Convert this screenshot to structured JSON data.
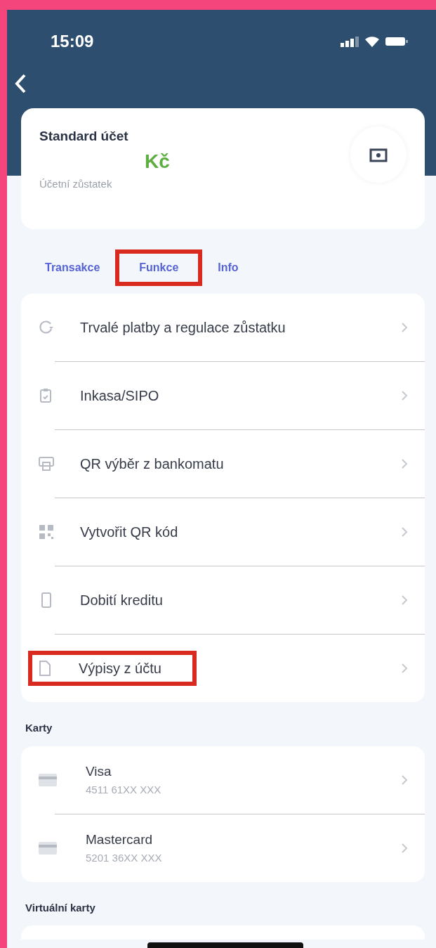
{
  "status_bar": {
    "time": "15:09"
  },
  "account": {
    "title": "Standard účet",
    "balance_currency": "Kč",
    "balance_label": "Účetní zůstatek"
  },
  "tabs": [
    {
      "label": "Transakce",
      "highlighted": false
    },
    {
      "label": "Funkce",
      "highlighted": true
    },
    {
      "label": "Info",
      "highlighted": false
    }
  ],
  "functions": [
    {
      "label": "Trvalé platby a regulace zůstatku",
      "highlighted": false
    },
    {
      "label": "Inkasa/SIPO",
      "highlighted": false
    },
    {
      "label": "QR výběr z bankomatu",
      "highlighted": false
    },
    {
      "label": "Vytvořit QR kód",
      "highlighted": false
    },
    {
      "label": "Dobití kreditu",
      "highlighted": false
    },
    {
      "label": "Výpisy z účtu",
      "highlighted": true
    }
  ],
  "cards_section": {
    "title": "Karty",
    "items": [
      {
        "name": "Visa",
        "number": "4511 61XX XXX"
      },
      {
        "name": "Mastercard",
        "number": "5201 36XX XXX"
      }
    ]
  },
  "virtual_cards_section": {
    "title": "Virtuální karty"
  }
}
